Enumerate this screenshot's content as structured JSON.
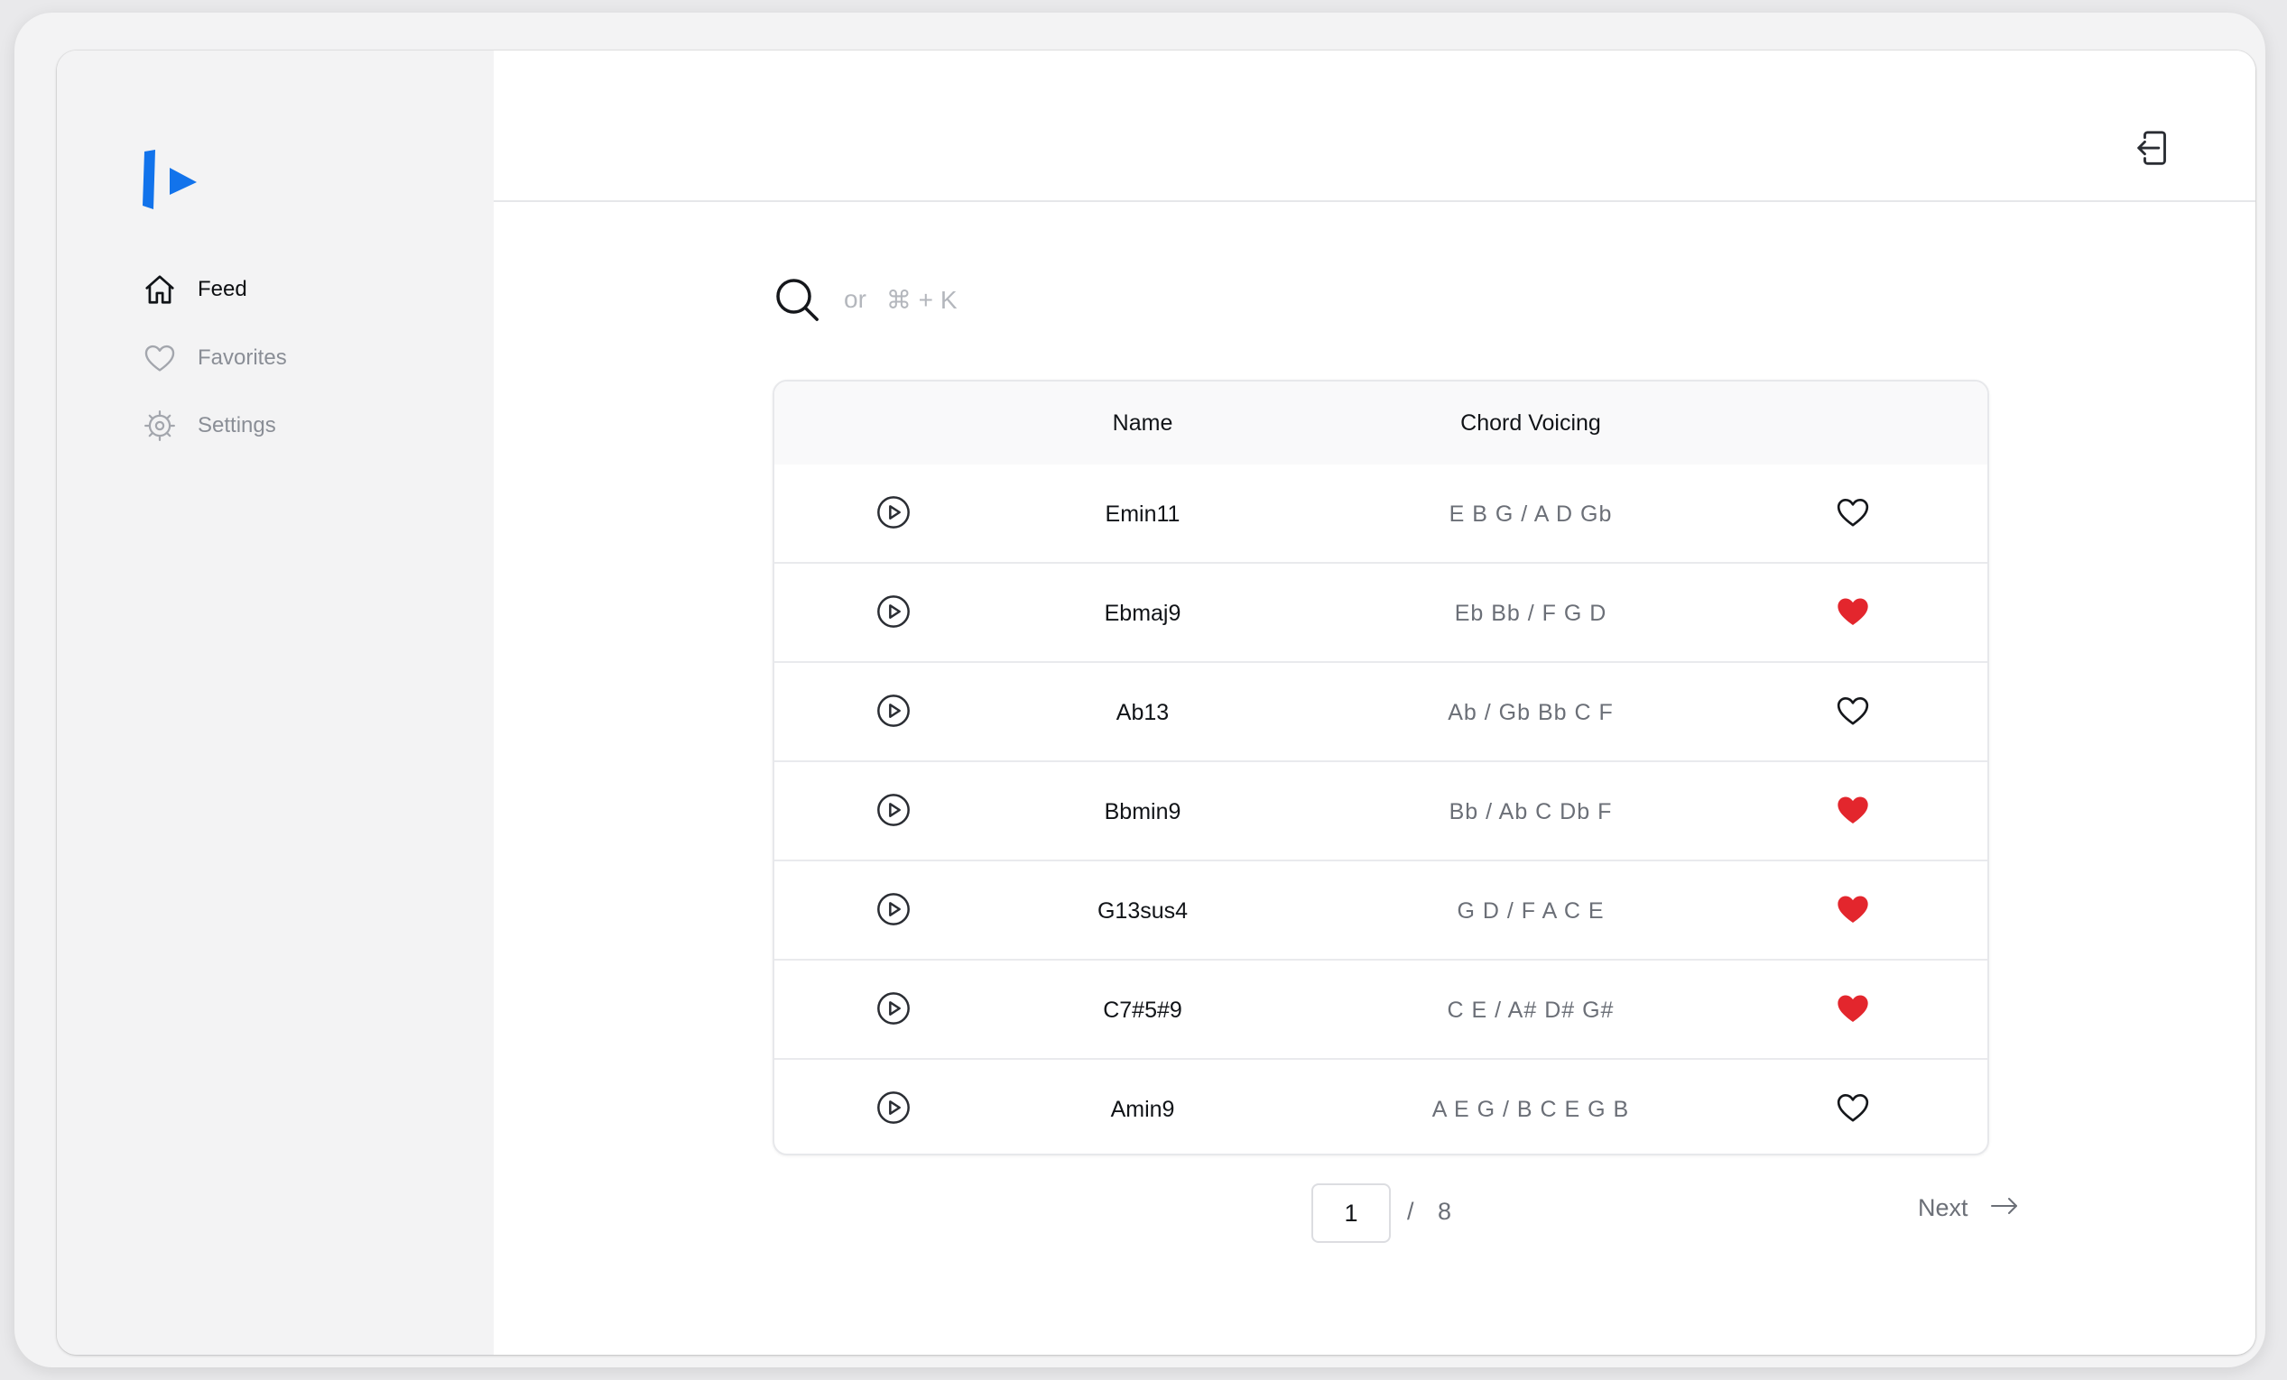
{
  "sidebar": {
    "logo": "app-logo",
    "items": [
      {
        "label": "Feed",
        "icon": "home-icon",
        "active": true
      },
      {
        "label": "Favorites",
        "icon": "heart-outline-icon",
        "active": false
      },
      {
        "label": "Settings",
        "icon": "gear-icon",
        "active": false
      }
    ]
  },
  "header": {
    "logout_icon": "logout-icon"
  },
  "search": {
    "or_text": "or",
    "shortcut": "⌘ + K"
  },
  "table": {
    "columns": [
      "Name",
      "Chord Voicing"
    ],
    "rows": [
      {
        "name": "Emin11",
        "voicing": "E B G / A D Gb",
        "favorite": false
      },
      {
        "name": "Ebmaj9",
        "voicing": "Eb Bb / F G D",
        "favorite": true
      },
      {
        "name": "Ab13",
        "voicing": "Ab / Gb Bb C F",
        "favorite": false
      },
      {
        "name": "Bbmin9",
        "voicing": "Bb / Ab C Db F",
        "favorite": true
      },
      {
        "name": "G13sus4",
        "voicing": "G D / F A C E",
        "favorite": true
      },
      {
        "name": "C7#5#9",
        "voicing": "C E / A# D# G#",
        "favorite": true
      },
      {
        "name": "Amin9",
        "voicing": "A E G / B C E G B",
        "favorite": false
      }
    ]
  },
  "pagination": {
    "current_page": "1",
    "separator": "/",
    "total_pages": "8",
    "next_label": "Next"
  },
  "colors": {
    "brand": "#1273eb",
    "favorite_active": "#e3262d",
    "muted_text": "#8a8e96"
  }
}
